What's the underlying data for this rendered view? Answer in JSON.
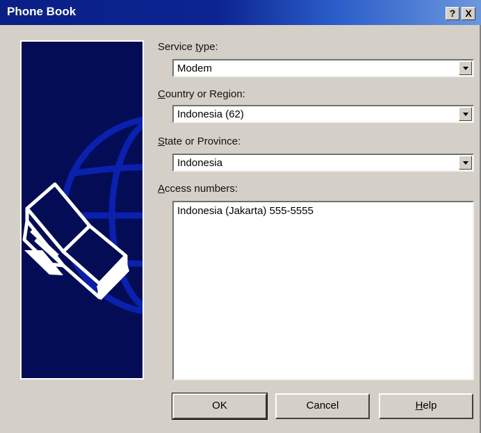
{
  "window": {
    "title": "Phone Book",
    "help_glyph": "?",
    "close_glyph": "X"
  },
  "fields": {
    "service_type": {
      "label_key": "S",
      "label_rest": "ervice ",
      "label_u": "t",
      "label_tail": "ype:",
      "value": "Modem"
    },
    "country": {
      "label_u": "C",
      "label_tail": "ountry or Region:",
      "value": "Indonesia (62)"
    },
    "state": {
      "label_u": "S",
      "label_tail": "tate or Province:",
      "value": "Indonesia"
    },
    "access_numbers": {
      "label_u": "A",
      "label_tail": "ccess numbers:",
      "items": [
        "Indonesia (Jakarta) 555-5555"
      ]
    }
  },
  "buttons": {
    "ok": "OK",
    "cancel": "Cancel",
    "help_u": "H",
    "help_tail": "elp"
  },
  "icons": {
    "side_image": "phone-book-globe-graphic",
    "combo_arrow": "chevron-down-icon"
  },
  "colors": {
    "title_bar_start": "#0a1f86",
    "title_bar_end": "#6c97dd",
    "dialog_face": "#d4d0c8",
    "side_panel": "#030c55"
  }
}
